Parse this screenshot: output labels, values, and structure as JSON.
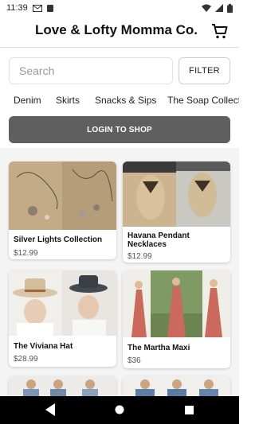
{
  "status_bar": {
    "time": "11:39",
    "icons": [
      "gmail-icon",
      "clipboard-icon",
      "wifi-icon",
      "signal-icon",
      "battery-icon"
    ]
  },
  "header": {
    "title": "Love & Lofty Momma Co."
  },
  "search": {
    "placeholder": "Search",
    "value": "",
    "filter_label": "FILTER"
  },
  "categories": [
    "Denim",
    "Skirts",
    "Snacks & Sips",
    "The Soap Collection"
  ],
  "login": {
    "label": "LOGIN TO SHOP"
  },
  "products": [
    {
      "name": "Silver Lights Collection",
      "price": "$12.99"
    },
    {
      "name": "Havana Pendant Necklaces",
      "price": "$12.99"
    },
    {
      "name": "The Viviana Hat",
      "price": "$28.99"
    },
    {
      "name": "The Martha Maxi",
      "price": "$36"
    }
  ],
  "colors": {
    "login_button": "#5f5f5f",
    "nav_bar": "#000000",
    "accent_maxi": "#c96a5c"
  }
}
